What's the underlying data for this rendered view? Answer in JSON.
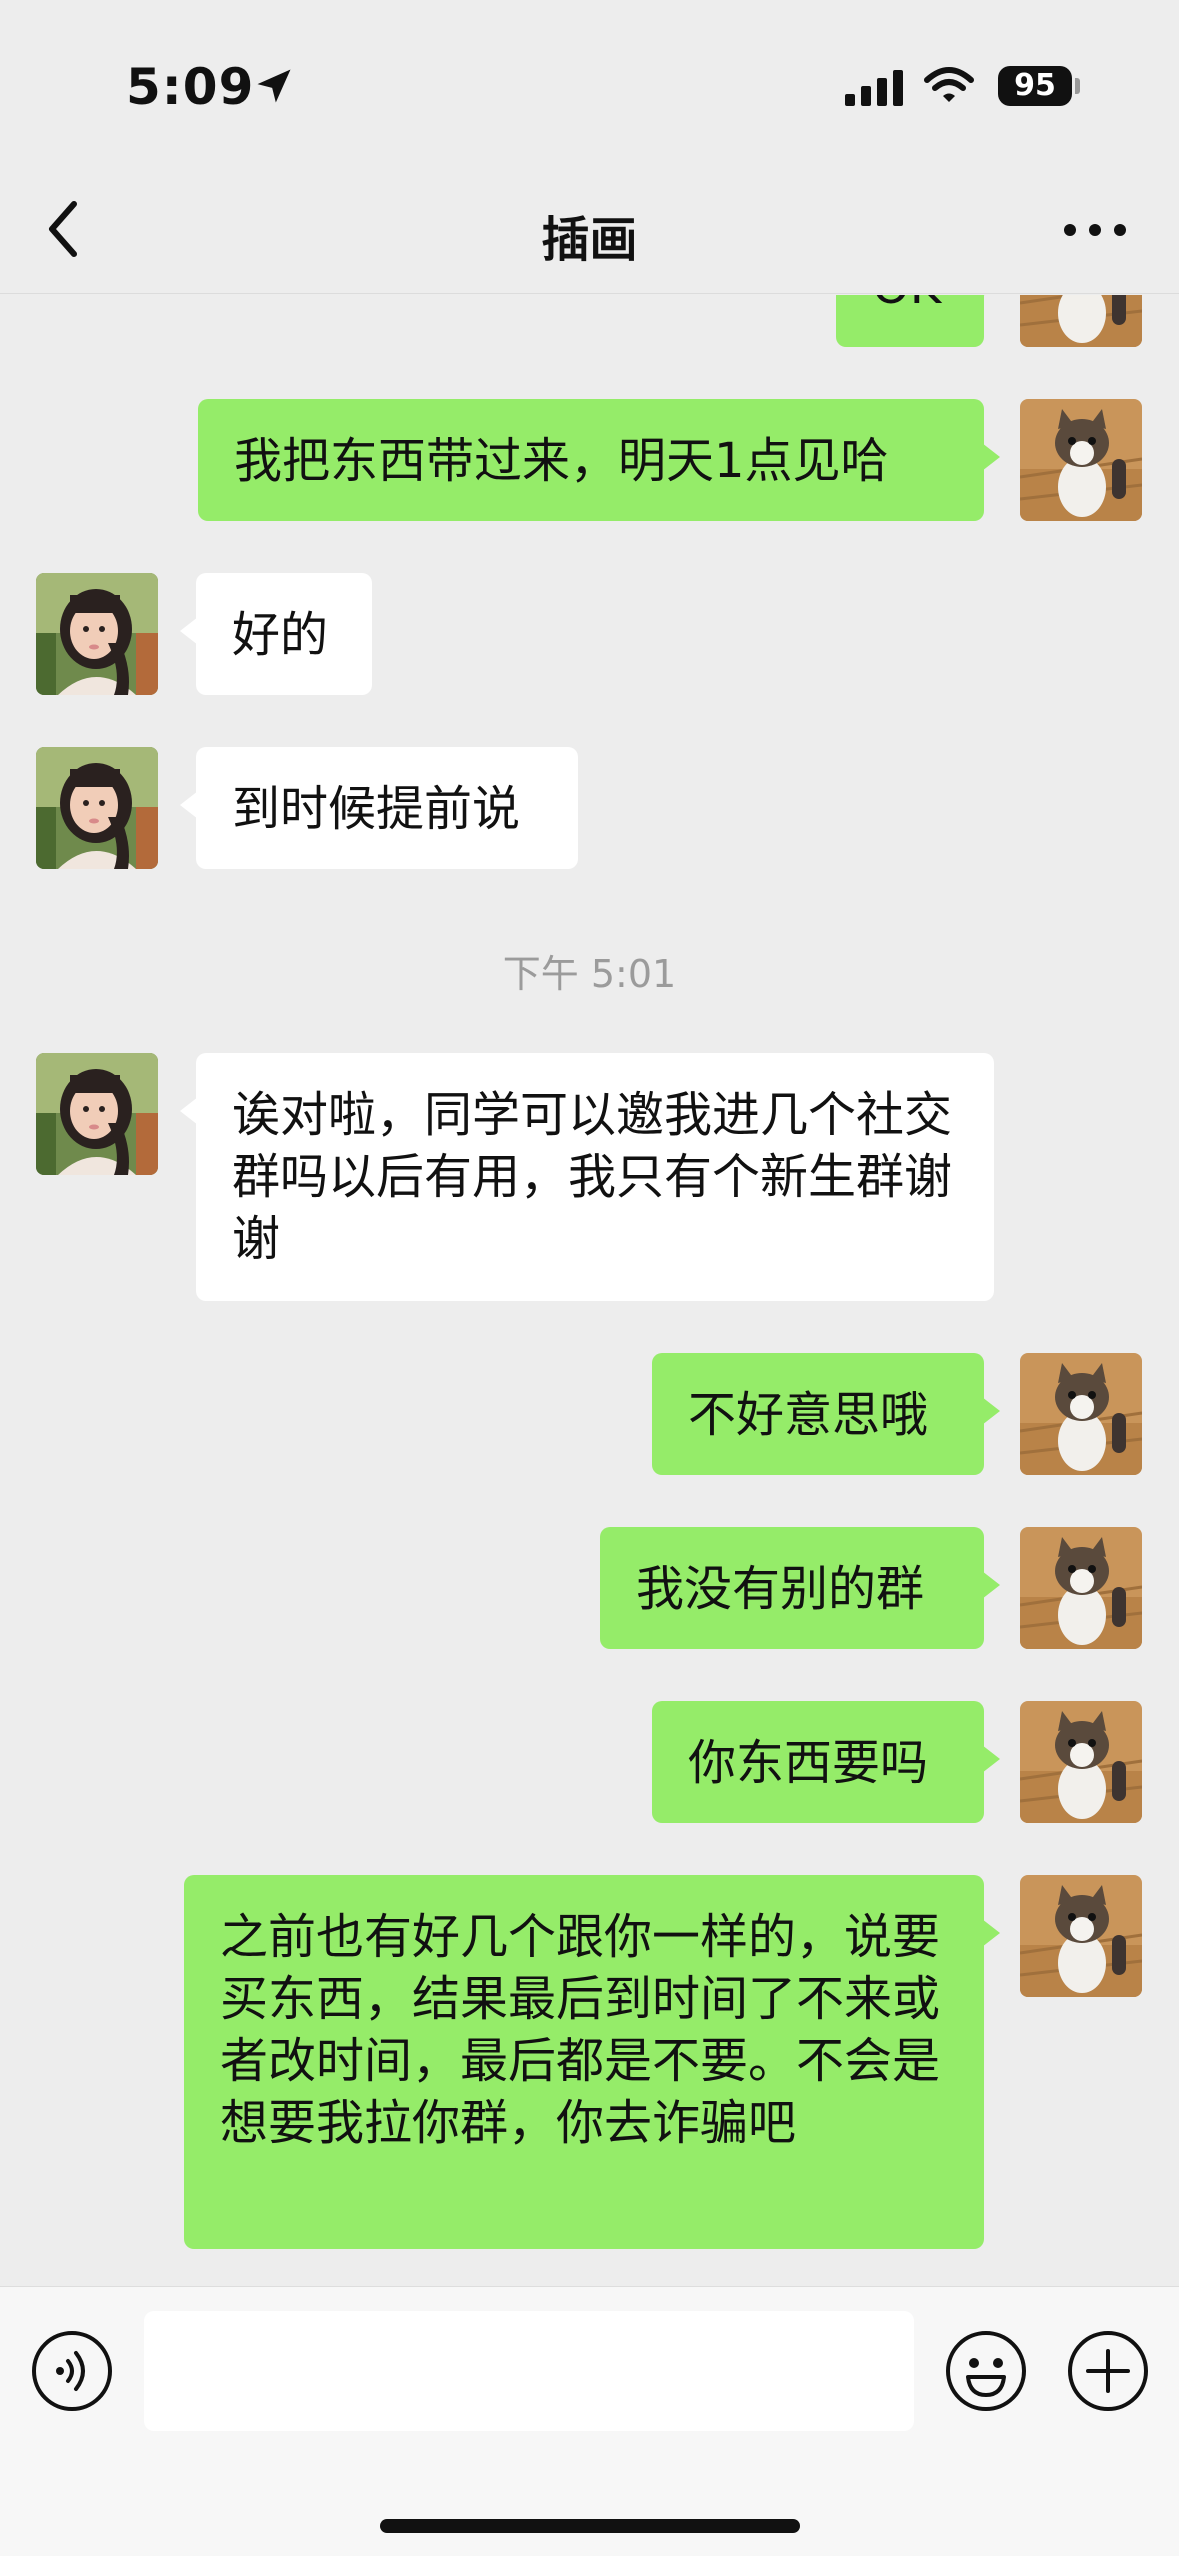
{
  "status_bar": {
    "time": "5:09",
    "battery": "95"
  },
  "nav": {
    "title": "插画"
  },
  "messages": [
    {
      "side": "right",
      "text": "OK"
    },
    {
      "side": "right",
      "text": "我把东西带过来，明天1点见哈"
    },
    {
      "side": "left",
      "text": "好的"
    },
    {
      "side": "left",
      "text": "到时候提前说"
    },
    {
      "side": "left",
      "text": "诶对啦，同学可以邀我进几个社交群吗以后有用，我只有个新生群谢谢"
    },
    {
      "side": "right",
      "text": "不好意思哦"
    },
    {
      "side": "right",
      "text": "我没有别的群"
    },
    {
      "side": "right",
      "text": "你东西要吗"
    },
    {
      "side": "right",
      "text": "之前也有好几个跟你一样的，说要买东西，结果最后到时间了不来或者改时间，最后都是不要。不会是想要我拉你群，你去诈骗吧"
    }
  ],
  "timestamp": "下午 5:01",
  "input": {
    "value": ""
  },
  "icons": {
    "back": "chevron-left-icon",
    "more": "more-dots-icon",
    "voice": "voice-icon",
    "emoji": "emoji-icon",
    "plus": "plus-icon"
  },
  "colors": {
    "bubble_mine": "#95ec69",
    "bubble_theirs": "#ffffff",
    "background": "#ededed"
  }
}
